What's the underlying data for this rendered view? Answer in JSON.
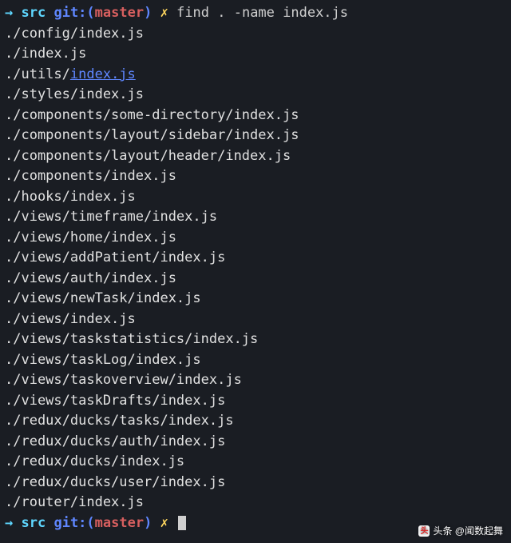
{
  "prompt1": {
    "arrow": "→",
    "cwd": "src",
    "git_label": "git:(",
    "branch": "master",
    "git_close": ")",
    "x": "✗",
    "command": "find . -name index.js"
  },
  "output": [
    "./config/index.js",
    "./index.js",
    "./utils/",
    "./styles/index.js",
    "./components/some-directory/index.js",
    "./components/layout/sidebar/index.js",
    "./components/layout/header/index.js",
    "./components/index.js",
    "./hooks/index.js",
    "./views/timeframe/index.js",
    "./views/home/index.js",
    "./views/addPatient/index.js",
    "./views/auth/index.js",
    "./views/newTask/index.js",
    "./views/index.js",
    "./views/taskstatistics/index.js",
    "./views/taskLog/index.js",
    "./views/taskoverview/index.js",
    "./views/taskDrafts/index.js",
    "./redux/ducks/tasks/index.js",
    "./redux/ducks/auth/index.js",
    "./redux/ducks/index.js",
    "./redux/ducks/user/index.js",
    "./router/index.js"
  ],
  "linked_filename": "index.js",
  "prompt2": {
    "arrow": "→",
    "cwd": "src",
    "git_label": "git:(",
    "branch": "master",
    "git_close": ")",
    "x": "✗"
  },
  "watermark": "头条 @闻数起舞"
}
